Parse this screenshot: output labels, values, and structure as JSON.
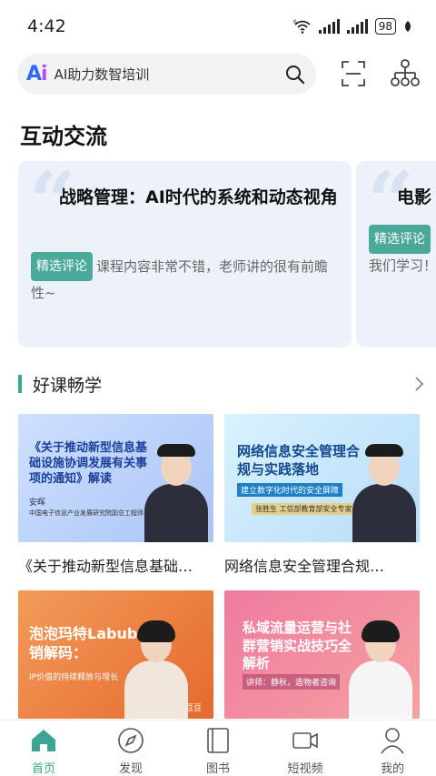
{
  "status_bar": {
    "time": "4:42",
    "wifi_label": "6",
    "battery": "98"
  },
  "search": {
    "text": "AI助力数智培训",
    "logo": "Ai"
  },
  "section_interaction": {
    "title": "互动交流"
  },
  "comment_cards": [
    {
      "title": "战略管理：AI时代的系统和动态视角",
      "tag": "精选评论",
      "comment": "课程内容非常不错，老师讲的很有前瞻性~"
    },
    {
      "title": "电影",
      "tag": "精选评论",
      "comment": "我们学习！"
    }
  ],
  "section_courses": {
    "title": "好课畅学"
  },
  "courses": [
    {
      "thumb_title": "《关于推动新型信息基础设施协调发展有关事项的通知》解读",
      "thumb_name": "安晖",
      "thumb_org": "中国电子信息产业发展研究院副总工程师",
      "title": "《关于推动新型信息基础…"
    },
    {
      "thumb_title": "网络信息安全管理合规与实践落地",
      "thumb_tagline": "建立数字化时代的安全屏障",
      "thumb_name": "张胜生 工信部教育部安全专家",
      "title": "网络信息安全管理合规…"
    },
    {
      "thumb_title": "泡泡玛特Labubu营销解码：",
      "thumb_tagline": "IP价值的持续释放与增长",
      "thumb_name": "讲师：黄豆豆"
    },
    {
      "thumb_title": "私域流量运营与社群营销实战技巧全解析",
      "thumb_name": "讲师：静秋，造物者咨询"
    }
  ],
  "nav": [
    {
      "label": "首页",
      "icon": "home-icon",
      "active": true
    },
    {
      "label": "发现",
      "icon": "compass-icon",
      "active": false
    },
    {
      "label": "图书",
      "icon": "book-icon",
      "active": false
    },
    {
      "label": "短视频",
      "icon": "video-icon",
      "active": false
    },
    {
      "label": "我的",
      "icon": "user-icon",
      "active": false
    }
  ],
  "colors": {
    "accent": "#3aa693",
    "tag_bg": "#4aa99a",
    "card_bg": "#edf2fa"
  }
}
